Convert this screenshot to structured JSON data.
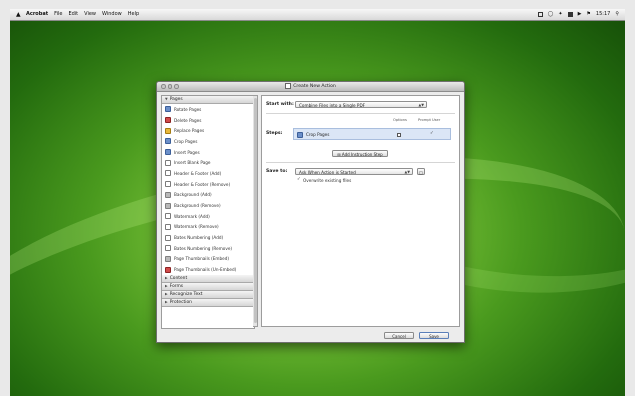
{
  "menubar": {
    "apple_icon": "apple-icon",
    "menus": [
      "Acrobat",
      "File",
      "Edit",
      "View",
      "Window",
      "Help"
    ],
    "clock": "15:17"
  },
  "dialog": {
    "title": "Create New Action",
    "sections_top": [
      {
        "label": "Pages"
      }
    ],
    "page_tools": [
      {
        "label": "Rotate Pages",
        "icon": "rotate-icon"
      },
      {
        "label": "Delete Pages",
        "icon": "delete-icon"
      },
      {
        "label": "Replace Pages",
        "icon": "replace-icon"
      },
      {
        "label": "Crop Pages",
        "icon": "crop-icon"
      },
      {
        "label": "Insert Pages",
        "icon": "insert-icon"
      },
      {
        "label": "Insert Blank Page",
        "icon": "blank-page-icon"
      },
      {
        "label": "Header & Footer (Add)",
        "icon": "header-footer-icon"
      },
      {
        "label": "Header & Footer (Remove)",
        "icon": "header-footer-icon"
      },
      {
        "label": "Background (Add)",
        "icon": "background-icon"
      },
      {
        "label": "Background (Remove)",
        "icon": "background-icon"
      },
      {
        "label": "Watermark (Add)",
        "icon": "watermark-icon"
      },
      {
        "label": "Watermark (Remove)",
        "icon": "watermark-icon"
      },
      {
        "label": "Bates Numbering (Add)",
        "icon": "bates-icon"
      },
      {
        "label": "Bates Numbering (Remove)",
        "icon": "bates-icon"
      },
      {
        "label": "Page Thumbnails (Embed)",
        "icon": "thumbnails-icon"
      },
      {
        "label": "Page Thumbnails (Un-Embed)",
        "icon": "thumbnails-icon"
      }
    ],
    "sections_bottom": [
      {
        "label": "Content"
      },
      {
        "label": "Forms"
      },
      {
        "label": "Recognize Text"
      },
      {
        "label": "Protection"
      }
    ],
    "start_with_label": "Start with:",
    "start_with_value": "Combine Files into a Single PDF",
    "steps_label": "Steps:",
    "options_header": "Options",
    "prompt_user_header": "Prompt User",
    "step_name": "Crop Pages",
    "add_instruction_label": "Add Instruction Step",
    "save_to_label": "Save to:",
    "save_to_value": "Ask When Action is Started",
    "overwrite_label": "Overwrite existing files",
    "cancel_label": "Cancel",
    "save_label": "Save"
  }
}
